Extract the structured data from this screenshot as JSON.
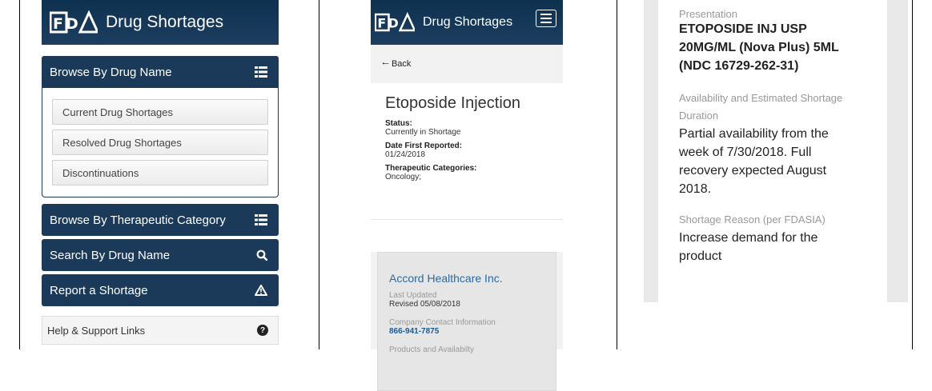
{
  "colors": {
    "navy": "#1b3a5a",
    "link": "#2b6aa0"
  },
  "panel1": {
    "logo": "FDA",
    "title": "Drug Shortages",
    "browse_by_name": {
      "label": "Browse By Drug Name",
      "icon": "list-icon",
      "items": [
        "Current Drug Shortages",
        "Resolved Drug Shortages",
        "Discontinuations"
      ]
    },
    "browse_by_category": {
      "label": "Browse By Therapeutic Category",
      "icon": "list-icon"
    },
    "search": {
      "label": "Search By Drug Name",
      "icon": "search-icon"
    },
    "report": {
      "label": "Report a Shortage",
      "icon": "warning-icon"
    },
    "help": {
      "label": "Help & Support Links",
      "icon": "question-circle-icon"
    }
  },
  "panel2": {
    "logo": "FDA",
    "title": "Drug Shortages",
    "back": "Back",
    "drug_title": "Etoposide Injection",
    "status_label": "Status:",
    "status_value": "Currently in Shortage",
    "date_label": "Date First Reported:",
    "date_value": "01/24/2018",
    "category_label": "Therapeutic Categories:",
    "category_value": "Oncology;",
    "company": {
      "name": "Accord Healthcare Inc.",
      "last_updated_label": "Last Updated",
      "last_updated_value": "Revised 05/08/2018",
      "contact_label": "Company Contact Information",
      "contact_value": "866-941-7875",
      "products_label": "Products and Availabilty"
    }
  },
  "panel3": {
    "presentation_label": "Presentation",
    "presentation_lines": [
      "ETOPOSIDE INJ USP",
      "20MG/ML (Nova Plus) 5ML",
      "(NDC 16729-262-31)"
    ],
    "availability_label_lines": [
      "Availability and Estimated Shortage",
      "Duration"
    ],
    "availability_lines": [
      "Partial availability from the",
      "week of 7/30/2018. Full",
      "recovery expected August",
      "2018."
    ],
    "reason_label": "Shortage Reason (per FDASIA)",
    "reason_lines": [
      "Increase demand for the",
      "product"
    ]
  }
}
